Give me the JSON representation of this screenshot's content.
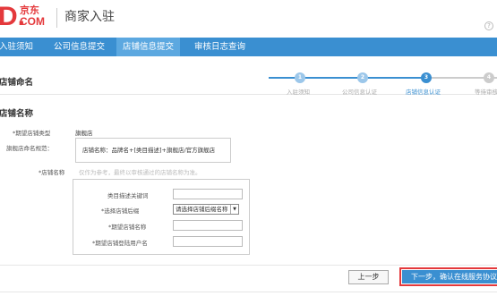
{
  "brand": {
    "logo_letter": "D.",
    "logo_cn": "京东",
    "logo_com": "COM",
    "site_title": "商家入驻"
  },
  "help_icon": "?",
  "nav": [
    "入驻须知",
    "公司信息提交",
    "店铺信息提交",
    "审核日志查询"
  ],
  "section_title": "店铺命名",
  "steps": [
    {
      "num": "1",
      "label": "入驻须知"
    },
    {
      "num": "2",
      "label": "公司信息认证"
    },
    {
      "num": "3",
      "label": "店铺信息认证"
    },
    {
      "num": "4",
      "label": "等待审核"
    }
  ],
  "form": {
    "title": "店铺名称",
    "expected_type_label": "*期望店铺类型",
    "expected_type_value": "旗舰店",
    "rule_label": "旗舰店命名规范：",
    "rule_text": "店铺名称：品牌名+[类目描述]+旗舰店/官方旗舰店",
    "store_name_label": "*店铺名称",
    "store_name_hint": "仅作为参考，最终以审核通过的店铺名称为准。",
    "category_keyword_label": "类目描述关键词",
    "select_suffix_label": "*选择店铺后缀",
    "select_suffix_value": "请选择店铺后缀名称",
    "expected_name_label": "*期望店铺名称",
    "expected_login_label": "*期望店铺登陆用户名"
  },
  "buttons": {
    "prev": "上一步",
    "next": "下一步，确认在线服务协议"
  },
  "colors": {
    "brand_red": "#e4393c",
    "nav_blue": "#3a8fd1",
    "nav_active": "#5ca8e0"
  }
}
